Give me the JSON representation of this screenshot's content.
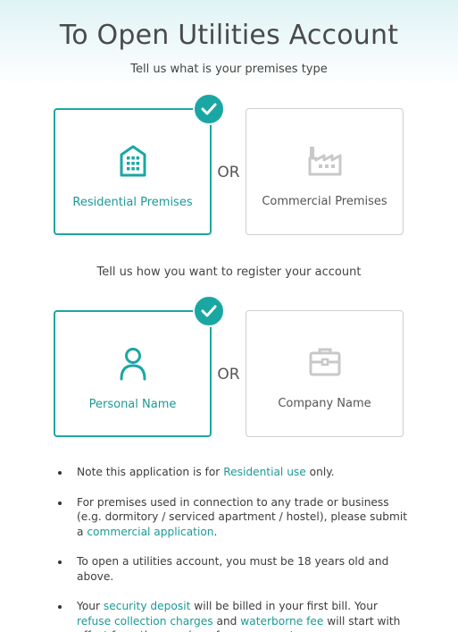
{
  "title": "To Open Utilities Account",
  "premises": {
    "prompt": "Tell us what is your premises type",
    "residential_label": "Residential Premises",
    "commercial_label": "Commercial Premises",
    "or_label": "OR",
    "selected": "Residential Premises"
  },
  "registration": {
    "prompt": "Tell us how you want to register your account",
    "personal_label": "Personal Name",
    "company_label": "Company Name",
    "or_label": "OR",
    "selected": "Personal Name"
  },
  "notes": {
    "n1_a": "Note this application is for ",
    "n1_link": "Residential use",
    "n1_b": " only.",
    "n2_a": "For premises used in connection to any trade or business (e.g. dormitory / serviced apartment / hostel), please submit a ",
    "n2_link": "commercial application",
    "n2_b": ".",
    "n3": "To open a utilities account, you must be 18 years old and above.",
    "n4_a": "Your ",
    "n4_link1": "security deposit",
    "n4_b": " will be billed in your first bill. Your ",
    "n4_link2": "refuse collection charges",
    "n4_c": " and ",
    "n4_link3": "waterborne fee",
    "n4_d": " will start with effect from the opening of your account."
  },
  "colors": {
    "accent": "#1aa7a4",
    "inactive_icon": "#c8c8c8"
  },
  "icons": {
    "residential": "apartment-building-icon",
    "commercial": "factory-icon",
    "personal": "person-icon",
    "company": "briefcase-icon",
    "check": "checkmark-icon"
  }
}
